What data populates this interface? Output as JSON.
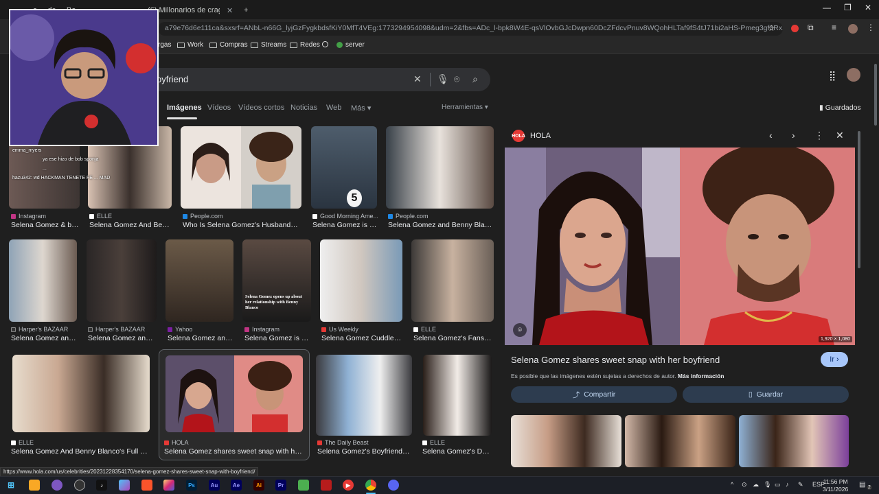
{
  "browser": {
    "tabs": [
      {
        "label": "a ... de ... Bo..."
      },
      {
        "label": "(6) Millonarios de crag: ¿Millona"
      }
    ],
    "new_tab": "+",
    "window_controls": [
      "—",
      "❐",
      "✕"
    ],
    "url": "a79e76d6e111ca&sxsrf=ANbL-n66G_lyjGzFygkbdsfKiY0MfT4VEg:1773294954098&udm=2&fbs=ADc_l-bpk8W4E-qsVlOvbGJcDwpn60DcZFdcvPnuv8WQohHLTaf9fS4tJ71bi2aHS-Pmeg3gf3Rx3g7wPLd9qB5u5EuZg..."
  },
  "bookmarks": [
    {
      "label": "rgas"
    },
    {
      "label": "Work"
    },
    {
      "label": "Compras"
    },
    {
      "label": "Streams"
    },
    {
      "label": "Redes"
    },
    {
      "label": "server"
    }
  ],
  "search": {
    "query": "oyfriend",
    "clear": "✕",
    "voice": "🎙",
    "lens": "⌾",
    "submit": "⌕"
  },
  "search_tabs": [
    "Imágenes",
    "Vídeos",
    "Vídeos cortos",
    "Noticias",
    "Web",
    "Más ▾"
  ],
  "tools": "Herramientas ▾",
  "saved": "Guardados",
  "results": [
    {
      "source": "Instagram",
      "title": "Selena Gomez & bo...",
      "fav": "#c13584"
    },
    {
      "source": "ELLE",
      "title": "Selena Gomez And Ben...",
      "fav": "#ffffff"
    },
    {
      "source": "People.com",
      "title": "Who Is Selena Gomez's Husband? Al...",
      "fav": "#1e88e5"
    },
    {
      "source": "Good Morning Ame...",
      "title": "Selena Gomez is e...",
      "fav": "#ffffff"
    },
    {
      "source": "People.com",
      "title": "Selena Gomez and Benny Blanc...",
      "fav": "#1e88e5"
    },
    {
      "source": "Harper's BAZAAR",
      "title": "Selena Gomez and...",
      "fav": "#333333"
    },
    {
      "source": "Harper's BAZAAR",
      "title": "Selena Gomez and ...",
      "fav": "#333333"
    },
    {
      "source": "Yahoo",
      "title": "Selena Gomez and...",
      "fav": "#7b1fa2"
    },
    {
      "source": "Instagram",
      "title": "Selena Gomez is o...",
      "fav": "#c13584"
    },
    {
      "source": "Us Weekly",
      "title": "Selena Gomez Cuddles ...",
      "fav": "#e53935"
    },
    {
      "source": "ELLE",
      "title": "Selena Gomez's Fans A...",
      "fav": "#ffffff"
    },
    {
      "source": "ELLE",
      "title": "Selena Gomez And Benny Blanco's Full Relat...",
      "fav": "#ffffff"
    },
    {
      "source": "HOLA",
      "title": "Selena Gomez shares sweet snap with her b...",
      "fav": "#e53935"
    },
    {
      "source": "The Daily Beast",
      "title": "Selena Gomez's Boyfriend S...",
      "fav": "#e53935"
    },
    {
      "source": "ELLE",
      "title": "Selena Gomez's Dati...",
      "fav": "#ffffff"
    }
  ],
  "image_text": "Selena Gomez opens up about her relationship with Benny Blanco",
  "badge_number": "5",
  "panel": {
    "source": "HOLA",
    "logo": "HOLA",
    "nav": [
      "‹",
      "›",
      "⋮",
      "✕"
    ],
    "dimensions": "1,920 × 1,080",
    "title": "Selena Gomez shares sweet snap with her boyfriend",
    "go": "Ir ›",
    "copyright_text": "Es posible que las imágenes estén sujetas a derechos de autor.",
    "more_info": "Más información",
    "share": "Compartir",
    "save": "Guardar"
  },
  "status_url": "https://www.hola.com/us/celebrities/20231228354170/selena-gomez-shares-sweet-snap-with-boyfriend/",
  "webcam": {
    "chat": [
      "emma_myers",
      "ya ese hizo de bob sponja",
      "...",
      "hazu342: wd HACKMAN TENETE FE ... MAD"
    ]
  },
  "taskbar": {
    "time": "11:56 PM",
    "date": "3/11/2026",
    "lang": "ESP",
    "notification_count": "2"
  },
  "colors": {
    "accent": "#a8c7fa",
    "hola_red": "#e53935"
  }
}
